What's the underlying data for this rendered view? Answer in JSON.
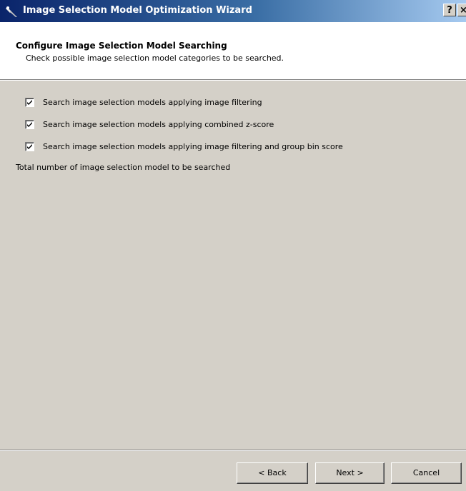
{
  "window": {
    "title": "Image Selection Model Optimization Wizard",
    "help_label": "?",
    "close_label": "×"
  },
  "header": {
    "title": "Configure Image Selection Model Searching",
    "subtitle": "Check possible image selection model categories to be searched."
  },
  "options": [
    {
      "label": "Search image selection models applying image filtering",
      "checked": true
    },
    {
      "label": "Search image selection models applying combined z-score",
      "checked": true
    },
    {
      "label": "Search image selection models applying image filtering and group bin score",
      "checked": true
    }
  ],
  "total_label": "Total number of image selection model to be searched",
  "buttons": {
    "back": "< Back",
    "next": "Next >",
    "cancel": "Cancel"
  }
}
